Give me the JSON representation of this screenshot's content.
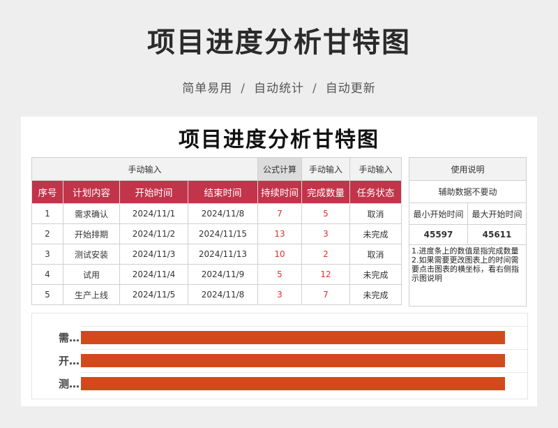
{
  "page": {
    "title": "项目进度分析甘特图",
    "subtitle_items": [
      "简单易用",
      "自动统计",
      "自动更新"
    ],
    "separator": "/"
  },
  "sheet": {
    "title": "项目进度分析甘特图",
    "group_headers": [
      "手动输入",
      "公式计算",
      "手动输入",
      "手动输入"
    ],
    "columns": [
      "序号",
      "计划内容",
      "开始时间",
      "结束时间",
      "持续时间",
      "完成数量",
      "任务状态"
    ],
    "rows": [
      {
        "no": "1",
        "task": "需求确认",
        "start": "2024/11/1",
        "end": "2024/11/8",
        "duration": "7",
        "done": "5",
        "status": "取消"
      },
      {
        "no": "2",
        "task": "开始排期",
        "start": "2024/11/2",
        "end": "2024/11/15",
        "duration": "13",
        "done": "3",
        "status": "未完成"
      },
      {
        "no": "3",
        "task": "测试安装",
        "start": "2024/11/3",
        "end": "2024/11/13",
        "duration": "10",
        "done": "2",
        "status": "取消"
      },
      {
        "no": "4",
        "task": "试用",
        "start": "2024/11/4",
        "end": "2024/11/9",
        "duration": "5",
        "done": "12",
        "status": "未完成"
      },
      {
        "no": "5",
        "task": "生产上线",
        "start": "2024/11/5",
        "end": "2024/11/8",
        "duration": "3",
        "done": "7",
        "status": "未完成"
      }
    ]
  },
  "side": {
    "header": "使用说明",
    "aux_title": "辅助数据不要动",
    "min_label": "最小开始时间",
    "max_label": "最大开始时间",
    "min_value": "45597",
    "max_value": "45611",
    "notes": "1.进度条上的数值是指完成数量\n2.如果需要更改图表上的时间需要点击图表的横坐标，看右侧指示图说明"
  },
  "chart_data": {
    "type": "bar",
    "orientation": "horizontal",
    "categories": [
      "需…",
      "开…",
      "测…"
    ],
    "values": [
      1,
      1,
      1
    ],
    "color": "#d24a1b",
    "grid": true
  }
}
